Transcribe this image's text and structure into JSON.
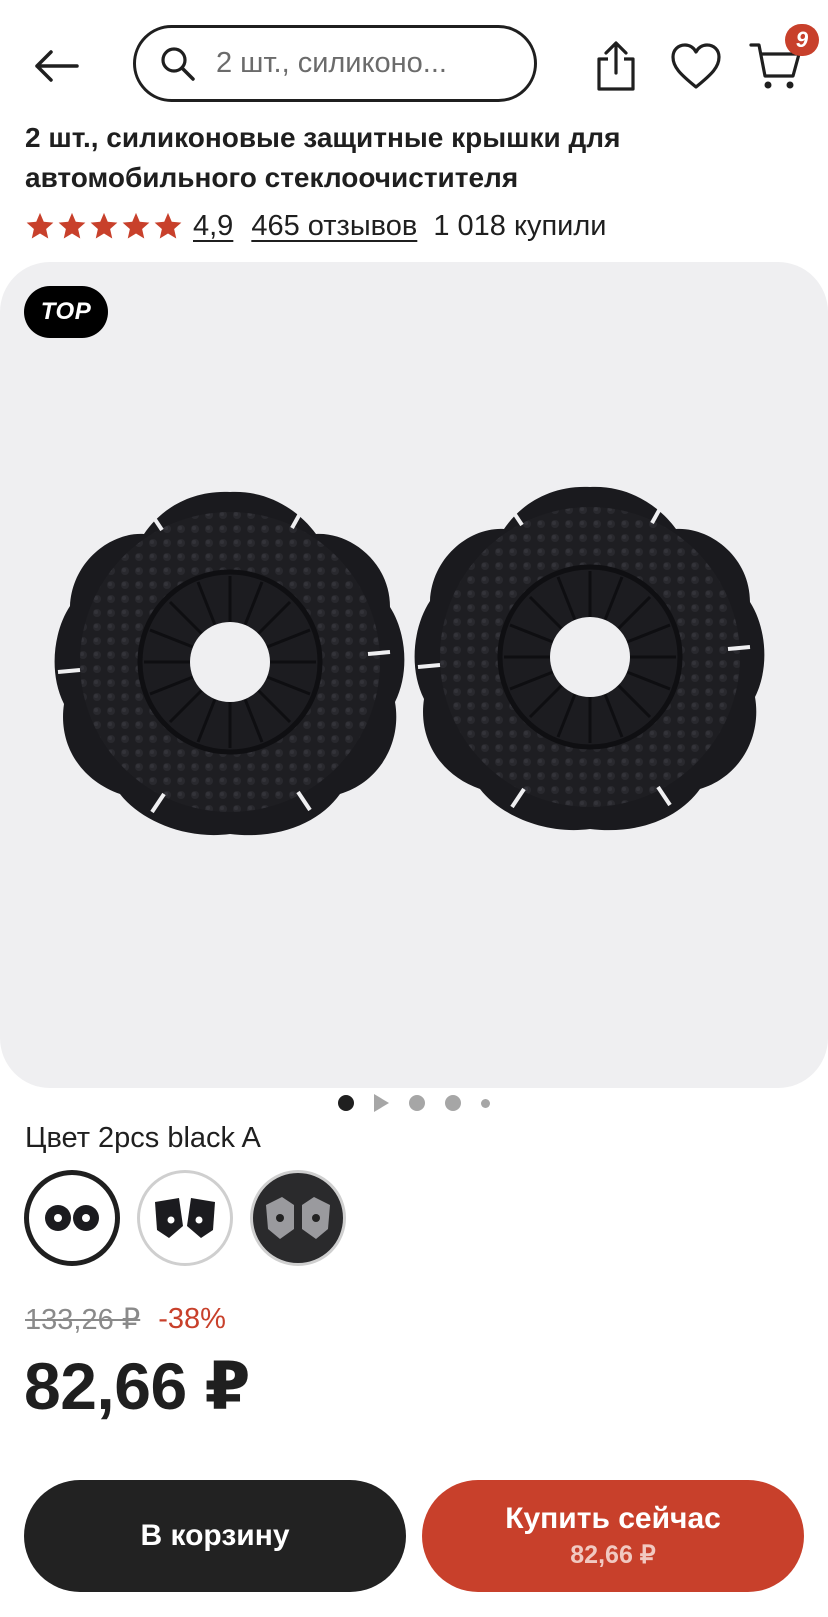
{
  "header": {
    "search_placeholder": "2 шт., силиконо...",
    "cart_count": "9"
  },
  "product": {
    "title": "2 шт., силиконовые защитные крышки для автомобильного стеклоочистителя",
    "rating": "4,9",
    "rating_stars": 5,
    "reviews": "465 отзывов",
    "bought": "1 018 купили"
  },
  "gallery": {
    "badge": "TOP",
    "image_count": 5,
    "active_index": 0
  },
  "color": {
    "label": "Цвет 2pcs black A",
    "options": [
      "2pcs black A",
      "black B",
      "gray"
    ],
    "selected_index": 0
  },
  "pricing": {
    "old_price": "133,26 ₽",
    "discount": "-38%",
    "price": "82,66 ₽"
  },
  "actions": {
    "add_to_cart": "В корзину",
    "buy_now": "Купить сейчас",
    "buy_now_price": "82,66 ₽"
  },
  "colors": {
    "accent": "#c8402b",
    "dark": "#222222",
    "gallery_bg": "#efeff1"
  }
}
